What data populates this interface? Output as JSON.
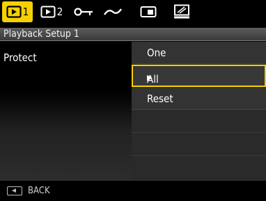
{
  "tabs": [
    {
      "number": "1",
      "icon": "playback-icon",
      "active": true
    },
    {
      "number": "2",
      "icon": "playback-icon",
      "active": false
    },
    {
      "number": "",
      "icon": "key-icon",
      "active": false
    },
    {
      "number": "",
      "icon": "wrench-icon",
      "active": false
    },
    {
      "number": "",
      "icon": "memory-card-icon",
      "active": false
    },
    {
      "number": "",
      "icon": "tv-icon",
      "active": false
    }
  ],
  "header": {
    "title": "Playback Setup 1"
  },
  "setting": {
    "label": "Protect"
  },
  "options": [
    {
      "label": "One",
      "selected": false
    },
    {
      "label": "All",
      "selected": true
    },
    {
      "label": "Reset",
      "selected": false
    }
  ],
  "footer": {
    "back_label": "BACK",
    "back_icon": "left-key-icon"
  },
  "colors": {
    "accent": "#f6d000",
    "background": "#000000",
    "panel": "#2a2a2a"
  }
}
